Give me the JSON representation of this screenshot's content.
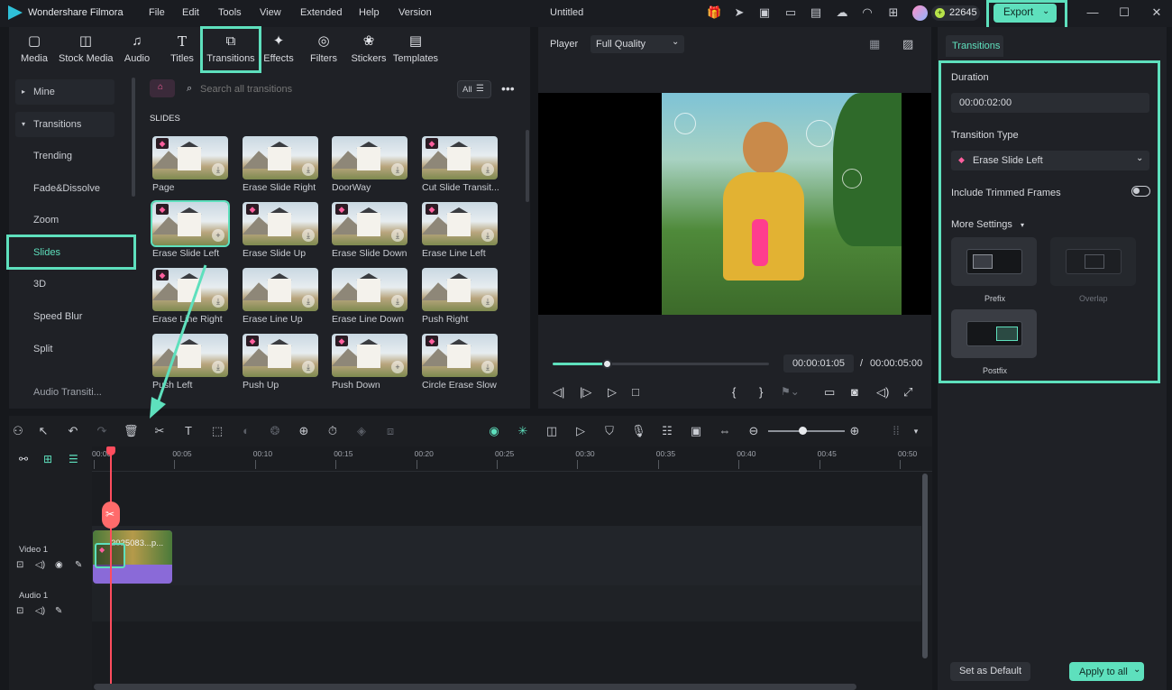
{
  "app": {
    "name": "Wondershare Filmora",
    "document_title": "Untitled",
    "credits": "22645",
    "export_label": "Export",
    "menu": [
      "File",
      "Edit",
      "Tools",
      "View",
      "Extended",
      "Help",
      "Version"
    ]
  },
  "toolbar_tabs": [
    {
      "label": "Media",
      "icon": "media-icon"
    },
    {
      "label": "Stock Media",
      "icon": "stock-media-icon"
    },
    {
      "label": "Audio",
      "icon": "music-note-icon"
    },
    {
      "label": "Titles",
      "icon": "text-t-icon"
    },
    {
      "label": "Transitions",
      "icon": "transition-icon",
      "active": true
    },
    {
      "label": "Effects",
      "icon": "effects-icon"
    },
    {
      "label": "Filters",
      "icon": "filters-icon"
    },
    {
      "label": "Stickers",
      "icon": "stickers-icon"
    },
    {
      "label": "Templates",
      "icon": "templates-icon"
    }
  ],
  "sidebar": {
    "items": [
      {
        "label": "Mine",
        "group": true
      },
      {
        "label": "Transitions",
        "group": true
      },
      {
        "label": "Trending"
      },
      {
        "label": "Fade&Dissolve"
      },
      {
        "label": "Zoom"
      },
      {
        "label": "Slides",
        "selected": true
      },
      {
        "label": "3D"
      },
      {
        "label": "Speed Blur"
      },
      {
        "label": "Split"
      },
      {
        "label": "Audio Transiti..."
      }
    ]
  },
  "search": {
    "placeholder": "Search all transitions",
    "filter_label": "All"
  },
  "section_title": "SLIDES",
  "transitions": [
    {
      "label": "Page",
      "premium": true
    },
    {
      "label": "Erase Slide Right",
      "premium": false
    },
    {
      "label": "DoorWay",
      "premium": false
    },
    {
      "label": "Cut Slide Transit...",
      "premium": true
    },
    {
      "label": "Erase Slide Left",
      "premium": true,
      "selected": true
    },
    {
      "label": "Erase Slide Up",
      "premium": true
    },
    {
      "label": "Erase Slide Down",
      "premium": true
    },
    {
      "label": "Erase Line Left",
      "premium": true
    },
    {
      "label": "Erase Line Right",
      "premium": true
    },
    {
      "label": "Erase Line Up",
      "premium": false
    },
    {
      "label": "Erase Line Down",
      "premium": false
    },
    {
      "label": "Push Right",
      "premium": false
    },
    {
      "label": "Push Left",
      "premium": false
    },
    {
      "label": "Push Up",
      "premium": true
    },
    {
      "label": "Push Down",
      "premium": true
    },
    {
      "label": "Circle Erase Slow",
      "premium": true
    }
  ],
  "player": {
    "label": "Player",
    "quality": "Full Quality",
    "current_time": "00:00:01:05",
    "separator": "/",
    "total_time": "00:00:05:00",
    "progress": 0.25
  },
  "properties": {
    "tab": "Transitions",
    "duration_label": "Duration",
    "duration_value": "00:00:02:00",
    "type_label": "Transition Type",
    "type_value": "Erase Slide Left",
    "trimmed_label": "Include Trimmed Frames",
    "more_settings_label": "More Settings",
    "modes": [
      {
        "label": "Prefix"
      },
      {
        "label": "Overlap"
      },
      {
        "label": "Postfix",
        "selected": true
      }
    ],
    "set_default_label": "Set as Default",
    "apply_all_label": "Apply to all"
  },
  "timeline": {
    "ruler": [
      "00:00",
      "00:05",
      "00:10",
      "00:15",
      "00:20",
      "00:25",
      "00:30",
      "00:35",
      "00:40",
      "00:45",
      "00:50"
    ],
    "video_track": "Video 1",
    "audio_track": "Audio 1",
    "clip_label": "2025083...p..."
  },
  "colors": {
    "accent": "#5ee0bd",
    "premium": "#ff5f9e",
    "playhead": "#ff4d5e",
    "clip": "#8a6ad8"
  }
}
